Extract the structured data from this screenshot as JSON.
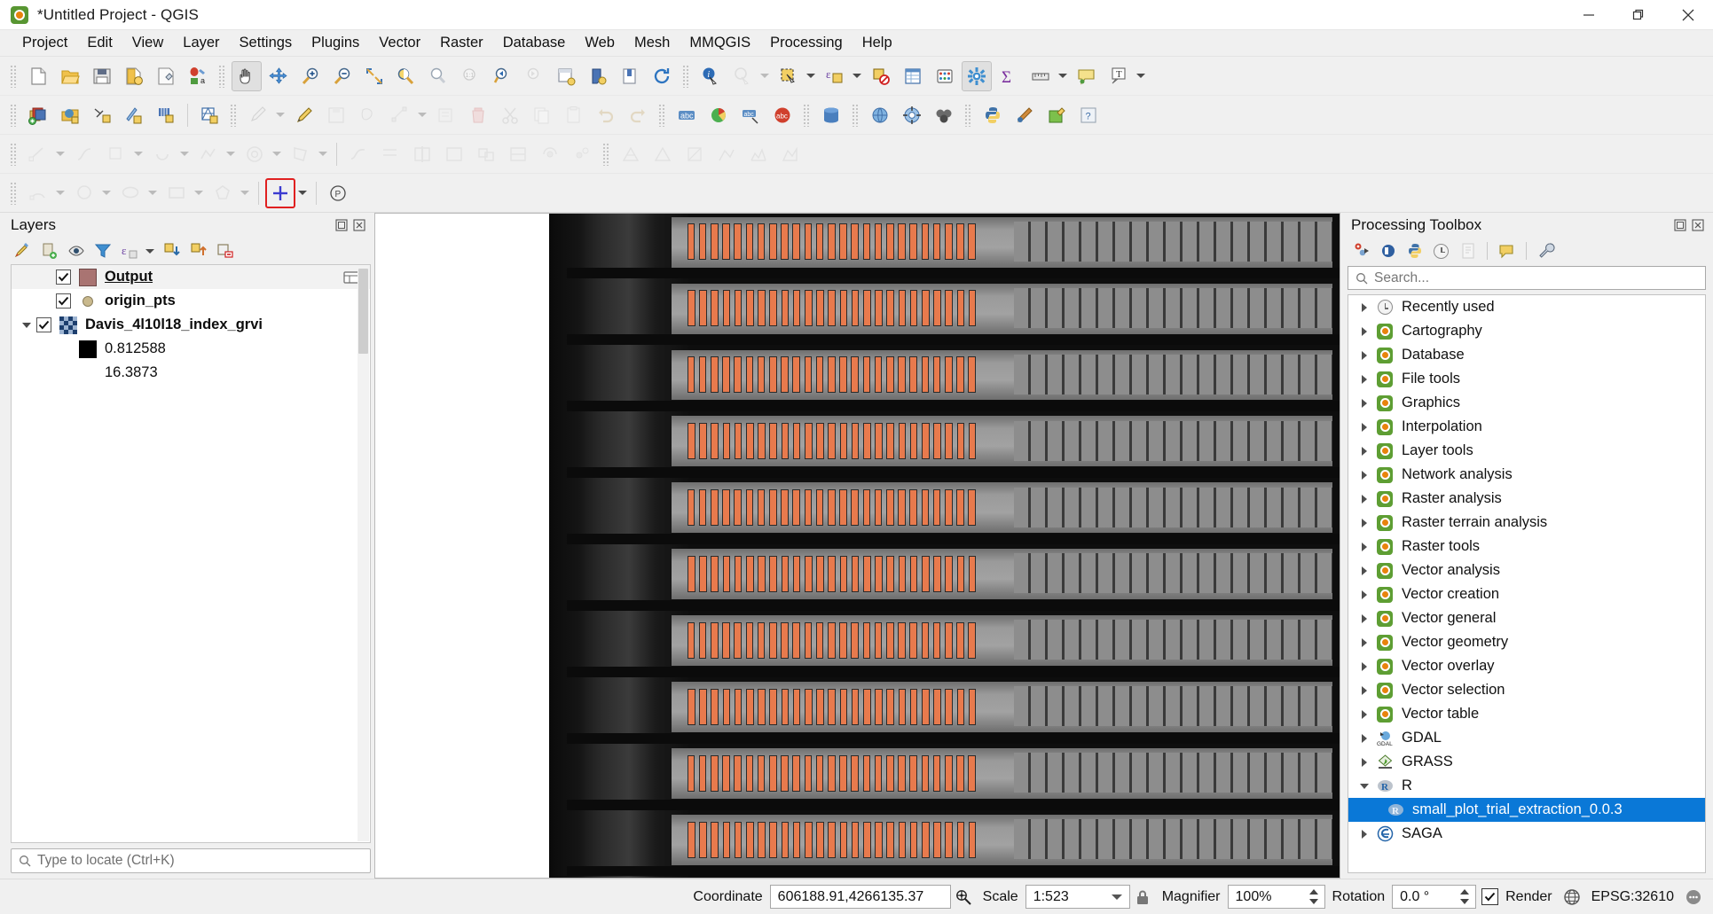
{
  "window": {
    "title": "*Untitled Project - QGIS",
    "app_icon": "qgis-logo-icon",
    "minimize_label": "Minimize",
    "maximize_label": "Restore",
    "close_label": "Close"
  },
  "menubar": {
    "items": [
      "Project",
      "Edit",
      "View",
      "Layer",
      "Settings",
      "Plugins",
      "Vector",
      "Raster",
      "Database",
      "Web",
      "Mesh",
      "MMQGIS",
      "Processing",
      "Help"
    ]
  },
  "toolbars": {
    "row1": [
      "new-project-icon",
      "open-project-icon",
      "save-project-icon",
      "save-project-as-icon",
      "new-print-layout-icon",
      "style-manager-icon",
      "pan-map-icon",
      "pan-to-selection-icon",
      "zoom-in-icon",
      "zoom-out-icon",
      "zoom-full-icon",
      "zoom-to-selection-icon",
      "zoom-to-layer-icon",
      "zoom-native-icon",
      "zoom-last-icon",
      "zoom-next-icon",
      "refresh-icon",
      "new-map-view-icon",
      "new-3d-map-view-icon",
      "redraw-icon",
      "identify-features-icon",
      "run-feature-action-icon",
      "select-features-icon",
      "select-by-expression-icon",
      "deselect-features-icon",
      "open-attribute-table-icon",
      "field-calculator-icon",
      "options-icon",
      "statistical-summary-icon",
      "measure-line-icon",
      "map-tips-icon",
      "text-annotation-icon"
    ],
    "row2": [
      "add-layers-group-icon",
      "data-source-manager-icon",
      "add-vector-layer-icon",
      "add-delimited-text-icon",
      "add-raster-layer-icon",
      "add-mesh-layer-icon",
      "current-edits-icon",
      "toggle-editing-icon",
      "save-layer-edits-icon",
      "add-feature-icon",
      "vertex-tool-icon",
      "modify-attributes-icon",
      "delete-selected-icon",
      "cut-features-icon",
      "copy-features-icon",
      "paste-features-icon",
      "undo-icon",
      "redo-icon",
      "label-icon",
      "diagram-icon",
      "move-label-icon",
      "change-label-icon",
      "db-manager-icon",
      "metasearch-icon",
      "georeferencer-icon",
      "grass-icon",
      "python-console-icon",
      "python-editor-icon",
      "plugin-manager-icon",
      "help-icon"
    ],
    "row3": [
      "pan-icon2",
      "advanced-digitizing-icon",
      "enable-tracing-icon",
      "move-feature-icon",
      "rotate-feature-icon",
      "simplify-feature-icon",
      "add-ring-icon",
      "add-part-icon",
      "fill-ring-icon",
      "delete-ring-icon",
      "delete-part-icon",
      "reshape-features-icon",
      "offset-curve-icon",
      "split-features-icon",
      "split-parts-icon",
      "merge-features-icon",
      "merge-attributes-icon",
      "rotate-point-symbols-icon",
      "offset-point-symbol-icon",
      "mesh-digitizing-icon",
      "mesh-select-icon",
      "mesh-transform-icon",
      "mesh-force-icon",
      "profile-tool-icon",
      "elevation-profile-icon"
    ],
    "row4": [
      "shape-digitizing-icon",
      "circular-string-icon",
      "circle-tool-icon",
      "ellipse-tool-icon",
      "rectangle-tool-icon",
      "regular-polygon-tool-icon",
      "add-point-feature-icon",
      "processing-model-icon"
    ],
    "highlighted_tool": "add-point-feature-icon",
    "active_tool": "pan-map-icon"
  },
  "layers_panel": {
    "title": "Layers",
    "float_label": "Float panel",
    "close_label": "Close panel",
    "toolbar_icons": [
      "open-layer-styling-icon",
      "add-group-icon",
      "manage-map-themes-icon",
      "filter-legend-icon",
      "filter-legend-expression-icon",
      "expand-all-icon",
      "collapse-all-icon",
      "remove-layer-icon"
    ],
    "items": [
      {
        "name": "Output",
        "checked": true,
        "symbol": "polygon-symbol",
        "bold": true,
        "underline": true,
        "selected": true,
        "has_expander": false,
        "indent": 1,
        "edit_icon": "layer-editing-icon"
      },
      {
        "name": "origin_pts",
        "checked": true,
        "symbol": "point-symbol",
        "bold": true,
        "underline": false,
        "selected": false,
        "has_expander": false,
        "indent": 1
      },
      {
        "name": "Davis_4l10l18_index_grvi",
        "checked": true,
        "symbol": "raster-symbol",
        "bold": true,
        "underline": false,
        "selected": false,
        "has_expander": true,
        "expanded": true,
        "indent": 0
      },
      {
        "name": "0.812588",
        "checked": null,
        "symbol": "black-swatch",
        "bold": false,
        "underline": false,
        "selected": false,
        "has_expander": false,
        "indent": 2
      },
      {
        "name": "16.3873",
        "checked": null,
        "symbol": "none",
        "bold": false,
        "underline": false,
        "selected": false,
        "has_expander": false,
        "indent": 2
      }
    ]
  },
  "locator": {
    "placeholder": "Type to locate (Ctrl+K)",
    "icon": "search-icon"
  },
  "processing_toolbox": {
    "title": "Processing Toolbox",
    "float_label": "Float panel",
    "close_label": "Close panel",
    "toolbar_icons": [
      "open-model-icon",
      "add-model-icon",
      "create-new-script-icon",
      "history-icon",
      "results-viewer-icon",
      "edit-rendering-icon",
      "options-wrench-icon"
    ],
    "search": {
      "placeholder": "Search...",
      "icon": "search-icon",
      "value": ""
    },
    "tree": [
      {
        "label": "Recently used",
        "icon": "clock-icon",
        "expanded": false,
        "indent": 0
      },
      {
        "label": "Cartography",
        "icon": "qgis-icon",
        "expanded": false,
        "indent": 0
      },
      {
        "label": "Database",
        "icon": "qgis-icon",
        "expanded": false,
        "indent": 0
      },
      {
        "label": "File tools",
        "icon": "qgis-icon",
        "expanded": false,
        "indent": 0
      },
      {
        "label": "Graphics",
        "icon": "qgis-icon",
        "expanded": false,
        "indent": 0
      },
      {
        "label": "Interpolation",
        "icon": "qgis-icon",
        "expanded": false,
        "indent": 0
      },
      {
        "label": "Layer tools",
        "icon": "qgis-icon",
        "expanded": false,
        "indent": 0
      },
      {
        "label": "Network analysis",
        "icon": "qgis-icon",
        "expanded": false,
        "indent": 0
      },
      {
        "label": "Raster analysis",
        "icon": "qgis-icon",
        "expanded": false,
        "indent": 0
      },
      {
        "label": "Raster terrain analysis",
        "icon": "qgis-icon",
        "expanded": false,
        "indent": 0
      },
      {
        "label": "Raster tools",
        "icon": "qgis-icon",
        "expanded": false,
        "indent": 0
      },
      {
        "label": "Vector analysis",
        "icon": "qgis-icon",
        "expanded": false,
        "indent": 0
      },
      {
        "label": "Vector creation",
        "icon": "qgis-icon",
        "expanded": false,
        "indent": 0
      },
      {
        "label": "Vector general",
        "icon": "qgis-icon",
        "expanded": false,
        "indent": 0
      },
      {
        "label": "Vector geometry",
        "icon": "qgis-icon",
        "expanded": false,
        "indent": 0
      },
      {
        "label": "Vector overlay",
        "icon": "qgis-icon",
        "expanded": false,
        "indent": 0
      },
      {
        "label": "Vector selection",
        "icon": "qgis-icon",
        "expanded": false,
        "indent": 0
      },
      {
        "label": "Vector table",
        "icon": "qgis-icon",
        "expanded": false,
        "indent": 0
      },
      {
        "label": "GDAL",
        "icon": "gdal-icon",
        "expanded": false,
        "indent": 0
      },
      {
        "label": "GRASS",
        "icon": "grass-icon",
        "expanded": false,
        "indent": 0
      },
      {
        "label": "R",
        "icon": "r-icon",
        "expanded": true,
        "indent": 0
      },
      {
        "label": "small_plot_trial_extraction_0.0.3",
        "icon": "r-script-icon",
        "expanded": null,
        "indent": 1,
        "selected": true
      },
      {
        "label": "SAGA",
        "icon": "saga-icon",
        "expanded": false,
        "indent": 0
      }
    ],
    "selection_color": "#0a78d7"
  },
  "statusbar": {
    "coordinate_label": "Coordinate",
    "coordinate_value": "606188.91,4266135.37",
    "toggle_extents_icon": "toggle-extents-icon",
    "scale_label": "Scale",
    "scale_value": "1:523",
    "lock_icon": "lock-scale-icon",
    "magnifier_label": "Magnifier",
    "magnifier_value": "100%",
    "rotation_label": "Rotation",
    "rotation_value": "0.0 °",
    "render_label": "Render",
    "render_checked": true,
    "crs_label": "EPSG:32610",
    "crs_icon": "globe-icon",
    "messages_icon": "message-log-icon"
  },
  "canvas": {
    "background": "#ffffff",
    "plot_color": "#e87a4d",
    "plot_outline": "#2a2a2a",
    "band_count": 10,
    "plots_per_band": 25,
    "description": "Greyscale aerial NDVI/GRVI raster of a field trial with orange rectangular plot polygons overlaid in rows"
  }
}
